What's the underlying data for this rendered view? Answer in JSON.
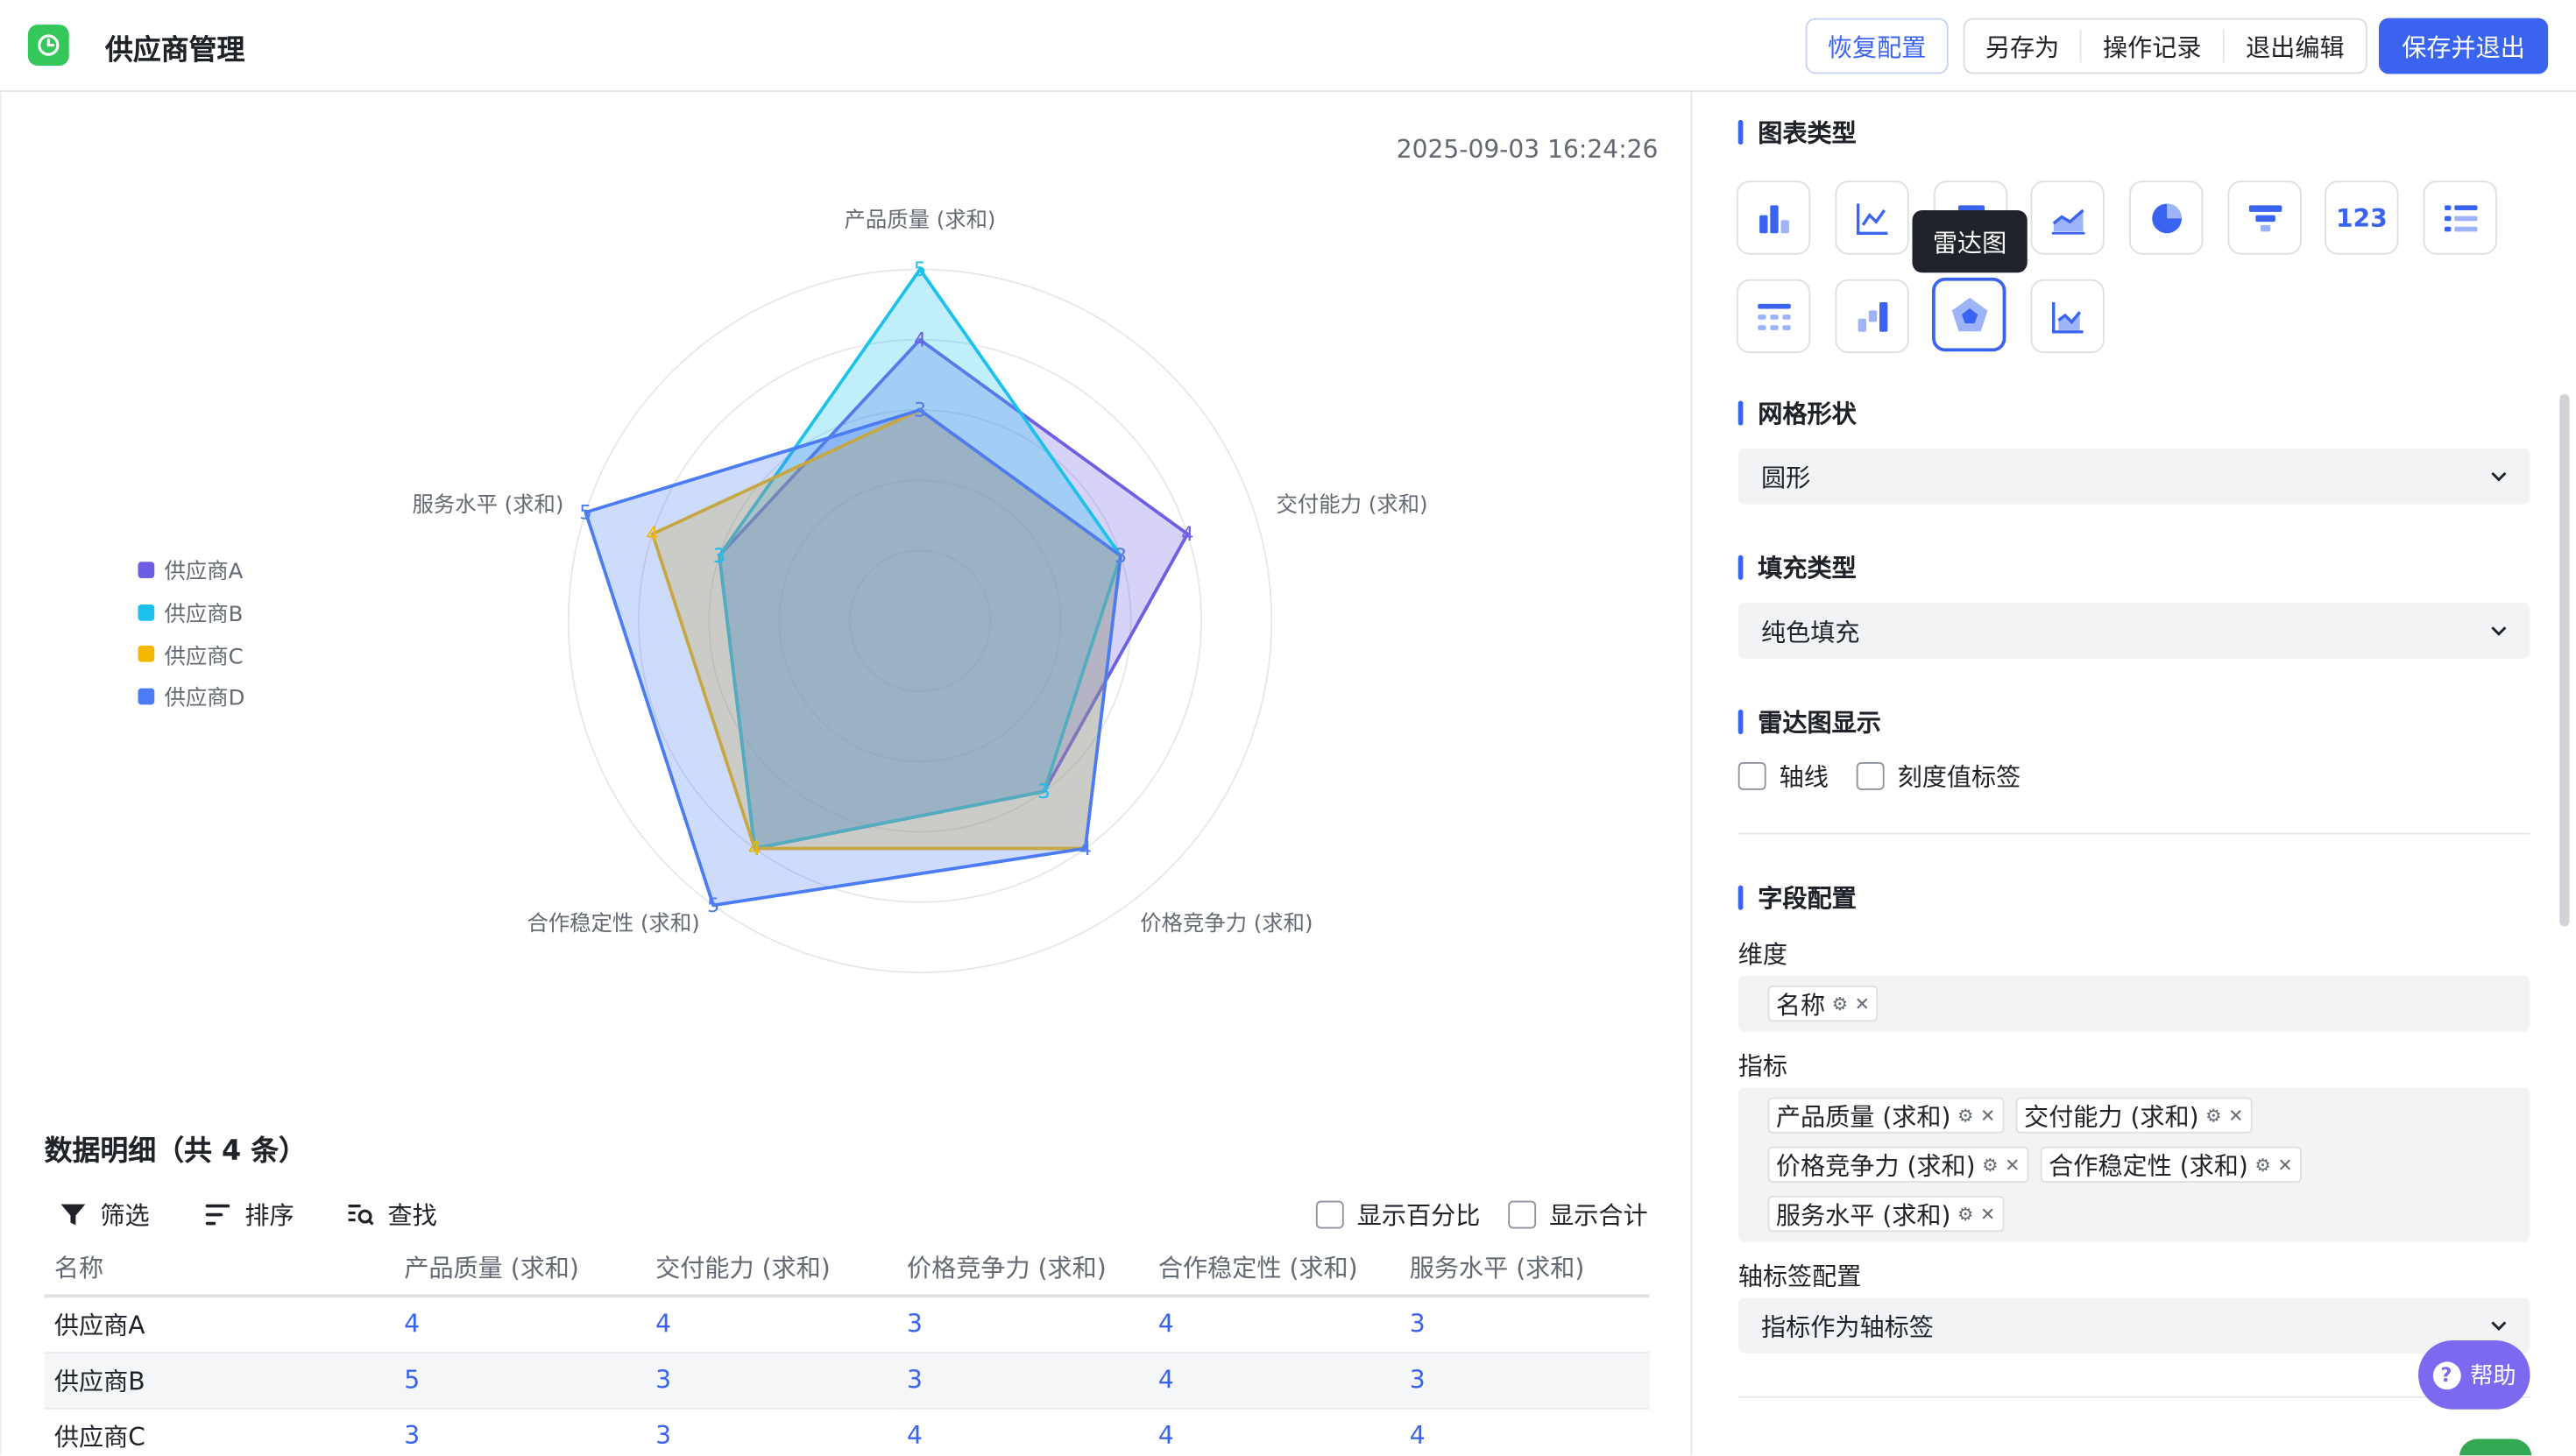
{
  "header": {
    "app_title": "供应商管理",
    "restore_label": "恢复配置",
    "save_as_label": "另存为",
    "history_label": "操作记录",
    "exit_edit_label": "退出编辑",
    "save_exit_label": "保存并退出"
  },
  "chart": {
    "timestamp": "2025-09-03 16:24:26"
  },
  "chart_data": {
    "type": "radar",
    "categories": [
      "产品质量 (求和)",
      "交付能力 (求和)",
      "价格竞争力 (求和)",
      "合作稳定性 (求和)",
      "服务水平 (求和)"
    ],
    "rlim": [
      0,
      5
    ],
    "series": [
      {
        "name": "供应商A",
        "values": [
          4,
          4,
          3,
          4,
          3
        ],
        "color": "#6c5fe6"
      },
      {
        "name": "供应商B",
        "values": [
          5,
          3,
          3,
          4,
          3
        ],
        "color": "#1cc2ec"
      },
      {
        "name": "供应商C",
        "values": [
          3,
          3,
          4,
          4,
          4
        ],
        "color": "#f5b800"
      },
      {
        "name": "供应商D",
        "values": [
          3,
          3,
          4,
          5,
          5
        ],
        "color": "#4c7cf3"
      }
    ],
    "grid_shape": "circle",
    "fill": "solid",
    "legend_position": "left"
  },
  "table": {
    "title": "数据明细（共 4 条）",
    "filter_label": "筛选",
    "sort_label": "排序",
    "find_label": "查找",
    "show_percent_label": "显示百分比",
    "show_total_label": "显示合计",
    "columns": [
      "名称",
      "产品质量 (求和)",
      "交付能力 (求和)",
      "价格竞争力 (求和)",
      "合作稳定性 (求和)",
      "服务水平 (求和)"
    ],
    "rows": [
      [
        "供应商A",
        "4",
        "4",
        "3",
        "4",
        "3"
      ],
      [
        "供应商B",
        "5",
        "3",
        "3",
        "4",
        "3"
      ],
      [
        "供应商C",
        "3",
        "3",
        "4",
        "4",
        "4"
      ]
    ]
  },
  "panel": {
    "chart_type_title": "图表类型",
    "chart_type_icons": [
      "bar-chart-icon",
      "line-chart-icon",
      "column-chart-icon",
      "area-chart-icon",
      "pie-chart-icon",
      "funnel-chart-icon",
      "number-card-icon",
      "list-icon",
      "detail-table-icon",
      "waterfall-chart-icon",
      "radar-chart-icon",
      "combo-chart-icon"
    ],
    "number_icon_text": "123",
    "tooltip": "雷达图",
    "grid_shape_title": "网格形状",
    "grid_shape_value": "圆形",
    "fill_type_title": "填充类型",
    "fill_type_value": "纯色填充",
    "radar_display_title": "雷达图显示",
    "axis_line_label": "轴线",
    "tick_label_label": "刻度值标签",
    "field_config_title": "字段配置",
    "dimension_label": "维度",
    "dimension_tags": [
      "名称"
    ],
    "metric_label": "指标",
    "metric_tags": [
      "产品质量 (求和)",
      "交付能力 (求和)",
      "价格竞争力 (求和)",
      "合作稳定性 (求和)",
      "服务水平 (求和)"
    ],
    "axis_label_config_title": "轴标签配置",
    "axis_label_config_value": "指标作为轴标签",
    "help_label": "帮助"
  }
}
